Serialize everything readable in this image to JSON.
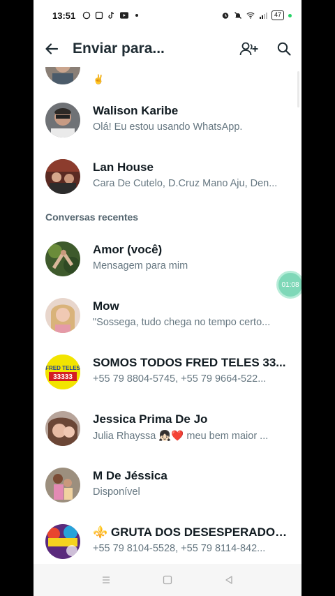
{
  "status_bar": {
    "time": "13:51",
    "battery": "47"
  },
  "header": {
    "title": "Enviar para..."
  },
  "top_partial": {
    "emoji": "✌️"
  },
  "contacts": [
    {
      "name": "Walison Karibe",
      "subtitle": "Olá! Eu estou usando WhatsApp."
    },
    {
      "name": "Lan House",
      "subtitle": "Cara De Cutelo, D.Cruz Mano Aju, Den..."
    }
  ],
  "section_title": "Conversas recentes",
  "recent": [
    {
      "name": "Amor (você)",
      "subtitle": "Mensagem para mim"
    },
    {
      "name": "Mow",
      "subtitle": "\"Sossega, tudo chega no tempo certo..."
    },
    {
      "name": "SOMOS TODOS FRED TELES 33...",
      "subtitle": "+55 79 8804-5745, +55 79 9664-522..."
    },
    {
      "name": "Jessica Prima De Jo",
      "subtitle": "Julia Rhayssa 👧🏻❤️ meu bem maior ..."
    },
    {
      "name": "M De Jéssica",
      "subtitle": "Disponível"
    },
    {
      "name": "⚜️ GRUTA DOS DESESPERADOS...",
      "subtitle": "+55 79 8104-5528, +55 79 8114-842..."
    }
  ],
  "avatar_texts": {
    "fred_teles": "FRED TELES",
    "fred_number": "33333"
  },
  "floating_timer": "01:08",
  "colors": {
    "accent": "#25d366",
    "title": "#1f2c33",
    "subtitle": "#667781"
  }
}
